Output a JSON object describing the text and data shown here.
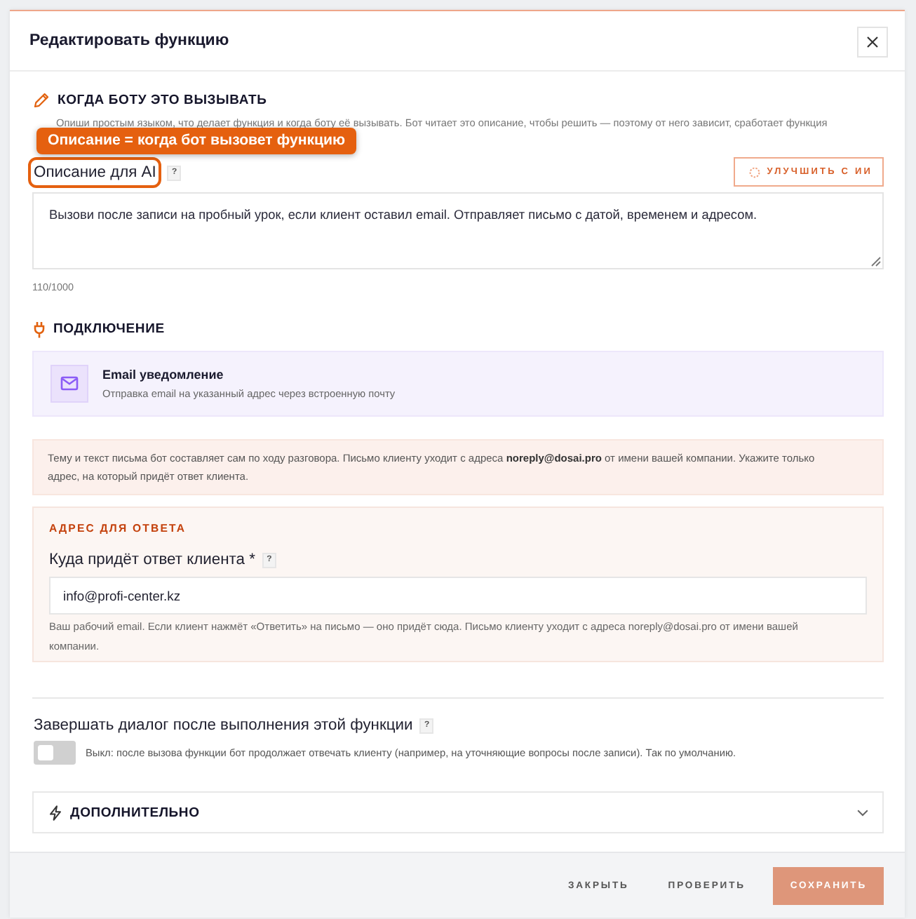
{
  "dialog": {
    "title": "Редактировать функцию"
  },
  "when_section": {
    "heading": "КОГДА БОТУ ЭТО ВЫЗЫВАТЬ",
    "intro": "Опиши простым языком, что делает функция и когда боту её вызывать. Бот читает это описание, чтобы решить — поэтому от него зависит, сработает функция",
    "callout": "Описание = когда бот вызовет функцию",
    "field": {
      "label": "Описание для AI",
      "highlighted": true,
      "help": "?",
      "improve_button": "УЛУЧШИТЬ С ИИ",
      "value": "Вызови после записи на пробный урок, если клиент оставил email. Отправляет письмо с датой, временем и адресом.",
      "counter": "110/1000"
    }
  },
  "connection_section": {
    "heading": "ПОДКЛЮЧЕНИЕ",
    "integration": {
      "title": "Email уведомление",
      "subtitle": "Отправка email на указанный адрес через встроенную почту"
    },
    "notice": "Тему и текст письма бот составляет сам по ходу разговора. Письмо клиенту уходит с адреса **noreply@dosai.pro** от имени вашей компании. Укажите только адрес, на который придёт ответ клиента.",
    "reply_address": {
      "heading": "АДРЕС ДЛЯ ОТВЕТА",
      "label": "Куда придёт ответ клиента *",
      "help": "?",
      "value": "info@profi-center.kz",
      "hint": "Ваш рабочий email. Если клиент нажмёт «Ответить» на письмо — оно придёт сюда. Письмо клиенту уходит с адреса noreply@dosai.pro от имени вашей компании."
    }
  },
  "end_dialog": {
    "label": "Завершать диалог после выполнения этой функции",
    "help": "?",
    "on": false,
    "description": "Выкл: после вызова функции бот продолжает отвечать клиенту (например, на уточняющие вопросы после записи). Так по умолчанию."
  },
  "advanced": {
    "heading": "ДОПОЛНИТЕЛЬНО",
    "expanded": false
  },
  "footer": {
    "buttons": [
      {
        "label": "ЗАКРЫТЬ",
        "kind": "text"
      },
      {
        "label": "ПРОВЕРИТЬ",
        "kind": "text"
      },
      {
        "label": "СОХРАНИТЬ",
        "kind": "primary"
      }
    ]
  }
}
